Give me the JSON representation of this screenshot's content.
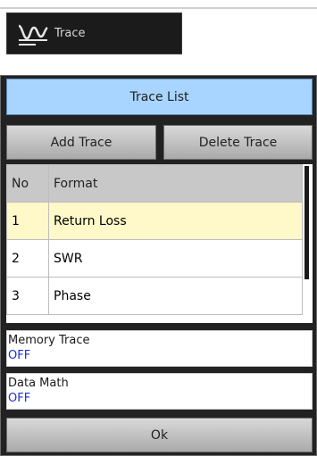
{
  "top_button": {
    "label": "Trace",
    "icon": "trace-icon"
  },
  "panel": {
    "title": "Trace List",
    "add_label": "Add Trace",
    "delete_label": "Delete Trace",
    "table": {
      "headers": {
        "no": "No",
        "format": "Format"
      },
      "rows": [
        {
          "no": "1",
          "format": "Return Loss",
          "selected": true
        },
        {
          "no": "2",
          "format": "SWR",
          "selected": false
        },
        {
          "no": "3",
          "format": "Phase",
          "selected": false
        }
      ]
    },
    "memory_trace": {
      "label": "Memory Trace",
      "value": "OFF"
    },
    "data_math": {
      "label": "Data Math",
      "value": "OFF"
    },
    "ok_label": "Ok"
  },
  "colors": {
    "title_bg": "#a8d5ff",
    "selected_row": "#fff8c8",
    "value_text": "#1e2fd0"
  }
}
